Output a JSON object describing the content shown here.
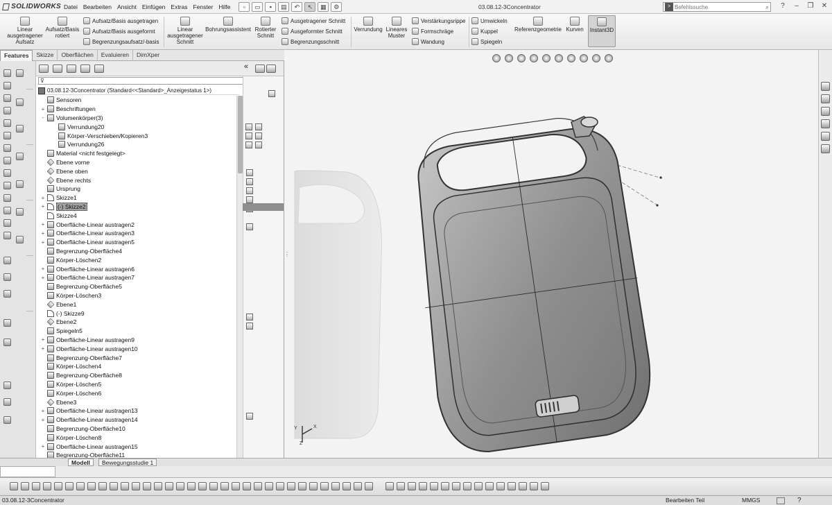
{
  "app": {
    "logo": "SOLIDWORKS",
    "document_title": "03.08.12-3Concentrator",
    "menu": [
      "Datei",
      "Bearbeiten",
      "Ansicht",
      "Einfügen",
      "Extras",
      "Fenster",
      "Hilfe"
    ],
    "command_search_placeholder": "Befehlssuche"
  },
  "ribbon": {
    "big": [
      {
        "label": "Linear ausgetragener Aufsatz",
        "lines": [
          "Linear",
          "ausgetragener",
          "Aufsatz"
        ]
      },
      {
        "label": "Aufsatz/Basis rotiert",
        "lines": [
          "Aufsatz/Basis",
          "rotiert"
        ]
      },
      {
        "label": "Linear ausgetragener Schnitt",
        "lines": [
          "Linear",
          "ausgetragener",
          "Schnitt"
        ]
      },
      {
        "label": "Bohrungsassistent",
        "lines": [
          "Bohrungsassistent"
        ]
      },
      {
        "label": "Rotierter Schnitt",
        "lines": [
          "Rotierter",
          "Schnitt"
        ]
      },
      {
        "label": "Verrundung",
        "lines": [
          "Verrundung"
        ]
      },
      {
        "label": "Lineares Muster",
        "lines": [
          "Lineares",
          "Muster"
        ]
      },
      {
        "label": "Referenzgeometrie",
        "lines": [
          "Referenzgeometrie"
        ]
      },
      {
        "label": "Kurven",
        "lines": [
          "Kurven"
        ]
      },
      {
        "label": "Instant3D",
        "lines": [
          "Instant3D"
        ]
      }
    ],
    "small": [
      "Aufsatz/Basis ausgetragen",
      "Aufsatz/Basis ausgeformt",
      "Begrenzungsaufsatz/-basis",
      "Ausgetragener Schnitt",
      "Ausgeformter Schnitt",
      "Begrenzungsschnitt",
      "Verstärkungsrippe",
      "Formschräge",
      "Wandung",
      "Umwickeln",
      "Kuppel",
      "Spiegeln"
    ]
  },
  "cm_tabs": [
    "Features",
    "Skizze",
    "Oberflächen",
    "Evaluieren",
    "DimXpert"
  ],
  "feature_manager": {
    "root": "03.08.12-3Concentrator  (Standard<<Standard>_Anzeigestatus 1>)",
    "items": [
      {
        "label": "Sensoren",
        "indent": 0,
        "exp": ""
      },
      {
        "label": "Beschriftungen",
        "indent": 0,
        "exp": "+"
      },
      {
        "label": "Volumenkörper(3)",
        "indent": 0,
        "exp": "-"
      },
      {
        "label": "Verrundung20",
        "indent": 1,
        "exp": ""
      },
      {
        "label": "Körper-Verschieben/Kopieren3",
        "indent": 1,
        "exp": ""
      },
      {
        "label": "Verrundung26",
        "indent": 1,
        "exp": ""
      },
      {
        "label": "Material <nicht festgelegt>",
        "indent": 0,
        "exp": ""
      },
      {
        "label": "Ebene vorne",
        "indent": 0,
        "exp": "",
        "kind": "plane"
      },
      {
        "label": "Ebene oben",
        "indent": 0,
        "exp": "",
        "kind": "plane"
      },
      {
        "label": "Ebene rechts",
        "indent": 0,
        "exp": "",
        "kind": "plane"
      },
      {
        "label": "Ursprung",
        "indent": 0,
        "exp": ""
      },
      {
        "label": "Skizze1",
        "indent": 0,
        "exp": "+",
        "kind": "sketch"
      },
      {
        "label": "(-) Skizze2",
        "indent": 0,
        "exp": "+",
        "kind": "sketch",
        "selected": true
      },
      {
        "label": "Skizze4",
        "indent": 0,
        "exp": "",
        "kind": "sketch"
      },
      {
        "label": "Oberfläche-Linear austragen2",
        "indent": 0,
        "exp": "+"
      },
      {
        "label": "Oberfläche-Linear austragen3",
        "indent": 0,
        "exp": "+"
      },
      {
        "label": "Oberfläche-Linear austragen5",
        "indent": 0,
        "exp": "+"
      },
      {
        "label": "Begrenzung-Oberfläche4",
        "indent": 0,
        "exp": ""
      },
      {
        "label": "Körper-Löschen2",
        "indent": 0,
        "exp": ""
      },
      {
        "label": "Oberfläche-Linear austragen6",
        "indent": 0,
        "exp": "+"
      },
      {
        "label": "Oberfläche-Linear austragen7",
        "indent": 0,
        "exp": "+"
      },
      {
        "label": "Begrenzung-Oberfläche5",
        "indent": 0,
        "exp": ""
      },
      {
        "label": "Körper-Löschen3",
        "indent": 0,
        "exp": ""
      },
      {
        "label": "Ebene1",
        "indent": 0,
        "exp": "",
        "kind": "plane"
      },
      {
        "label": "(-) Skizze9",
        "indent": 0,
        "exp": "",
        "kind": "sketch"
      },
      {
        "label": "Ebene2",
        "indent": 0,
        "exp": "",
        "kind": "plane"
      },
      {
        "label": "Spiegeln5",
        "indent": 0,
        "exp": ""
      },
      {
        "label": "Oberfläche-Linear austragen9",
        "indent": 0,
        "exp": "+"
      },
      {
        "label": "Oberfläche-Linear austragen10",
        "indent": 0,
        "exp": "+"
      },
      {
        "label": "Begrenzung-Oberfläche7",
        "indent": 0,
        "exp": ""
      },
      {
        "label": "Körper-Löschen4",
        "indent": 0,
        "exp": ""
      },
      {
        "label": "Begrenzung-Oberfläche8",
        "indent": 0,
        "exp": ""
      },
      {
        "label": "Körper-Löschen5",
        "indent": 0,
        "exp": ""
      },
      {
        "label": "Körper-Löschen6",
        "indent": 0,
        "exp": ""
      },
      {
        "label": "Ebene3",
        "indent": 0,
        "exp": "",
        "kind": "plane"
      },
      {
        "label": "Oberfläche-Linear austragen13",
        "indent": 0,
        "exp": "+"
      },
      {
        "label": "Oberfläche-Linear austragen14",
        "indent": 0,
        "exp": "+"
      },
      {
        "label": "Begrenzung-Oberfläche10",
        "indent": 0,
        "exp": ""
      },
      {
        "label": "Körper-Löschen8",
        "indent": 0,
        "exp": ""
      },
      {
        "label": "Oberfläche-Linear austragen15",
        "indent": 0,
        "exp": "+"
      },
      {
        "label": "Begrenzung-Oberfläche11",
        "indent": 0,
        "exp": ""
      }
    ]
  },
  "bottom_tabs": [
    "Modell",
    "Bewegungsstudie 1"
  ],
  "status": {
    "left": "03.08.12-3Concentrator",
    "mode": "Bearbeiten Teil",
    "units": "MMGS"
  },
  "viewport": {
    "triad_axes": [
      "X",
      "Y",
      "Z"
    ]
  }
}
